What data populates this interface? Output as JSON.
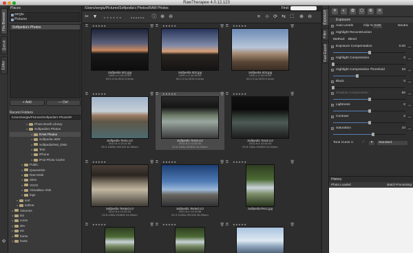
{
  "window": {
    "title": "RawTherapee 4.0.12.123"
  },
  "left_tabs": [
    "File Browser",
    "Queue",
    "Editor"
  ],
  "places": {
    "header": "Places",
    "items": [
      "sergiu",
      "Pictures"
    ],
    "favorite": "Softpedia's Photos"
  },
  "buttons": {
    "add": "+ Add",
    "del": "— Del"
  },
  "recent": {
    "label": "Recent Folders",
    "path": "/Users/sergiu/Pictures/Softpedia's Photos/R"
  },
  "tree": [
    {
      "label": "Photo Booth Library",
      "indent": 3,
      "selected": false
    },
    {
      "label": "Softpedia's Photos",
      "indent": 3,
      "selected": false
    },
    {
      "label": "RAW Photos",
      "indent": 4,
      "selected": true
    },
    {
      "label": "Softpedia HDR",
      "indent": 4,
      "selected": false
    },
    {
      "label": "SoftpediaTest_DNG",
      "indent": 4,
      "selected": false
    },
    {
      "label": "Test",
      "indent": 4,
      "selected": false
    },
    {
      "label": "iPhone",
      "indent": 4,
      "selected": false
    },
    {
      "label": "iPod Photo Cache",
      "indent": 4,
      "selected": false
    },
    {
      "label": "Public",
      "indent": 2,
      "selected": false
    },
    {
      "label": "Quarantine",
      "indent": 2,
      "selected": false
    },
    {
      "label": "Ram-Disk",
      "indent": 2,
      "selected": false
    },
    {
      "label": "Sites",
      "indent": 2,
      "selected": false
    },
    {
      "label": "VIIVO",
      "indent": 2,
      "selected": false
    },
    {
      "label": "VirtualBox VMs",
      "indent": 2,
      "selected": false
    },
    {
      "label": "logs",
      "indent": 2,
      "selected": false
    },
    {
      "label": "sort",
      "indent": 1,
      "selected": false
    },
    {
      "label": "softzet",
      "indent": 1,
      "selected": false
    },
    {
      "label": "Volumes",
      "indent": 0,
      "selected": false
    },
    {
      "label": "bin",
      "indent": 0,
      "selected": false
    },
    {
      "label": "cores",
      "indent": 0,
      "selected": false
    },
    {
      "label": "dev",
      "indent": 0,
      "selected": false
    },
    {
      "label": "etc",
      "indent": 0,
      "selected": false
    },
    {
      "label": "home",
      "indent": 0,
      "selected": false
    },
    {
      "label": "hosts",
      "indent": 0,
      "selected": false
    }
  ],
  "main": {
    "path": "/Users/sergiu/Pictures/Softpedia's Photos/RAW Photos",
    "find_label": "Find:"
  },
  "thumbs": [
    {
      "name": "Softpedia 001.jpg",
      "l1": "1900-1-0 00:00:00",
      "l2": "f/0.0 0.0s ISO0 0.0mm",
      "scene": "sunset"
    },
    {
      "name": "Softpedia 002.jpg",
      "l1": "1900-1-0 00:00:00",
      "l2": "f/0.0 0.0s ISO0 0.0mm",
      "scene": "sunset2"
    },
    {
      "name": "Softpedia 003.jpg",
      "l1": "1900-1-0 00:00:00",
      "l2": "f/0.0 0.0s ISO0 0.0mm",
      "scene": "ruin"
    },
    {
      "name": "Softpedia Test1.cr2",
      "l1": "2012-6-4 13:11:59",
      "l2": "f/5.3 1/800s ISO100 40.00mm",
      "scene": "canal"
    },
    {
      "name": "Softpedia Test3.cr2",
      "l1": "2012-6-4 12:52:34",
      "l2": "f/2.8 1/50s ISO800 24.00mm",
      "scene": "arch"
    },
    {
      "name": "Softpedia Test4.cr2",
      "l1": "2012-6-4 12:52:34",
      "l2": "f/2.8 1/50s ISO800 24.00mm",
      "scene": "archdark"
    },
    {
      "name": "Softpedia-Tested.cr2",
      "l1": "2012-6-4 12:52:34",
      "l2": "f/2.8 1/50s ISO800 24.00mm",
      "scene": "arch2"
    },
    {
      "name": "Softpedia Tested.cr2",
      "l1": "2012-6-4 13:16:58",
      "l2": "f/1.9 1/400s ISO100 35.00mm",
      "scene": "sky"
    },
    {
      "name": "SoftpediaTest1.jpg",
      "l1": "",
      "l2": "",
      "scene": "waterfall"
    },
    {
      "name": "",
      "l1": "",
      "l2": "",
      "scene": "waterfall"
    },
    {
      "name": "",
      "l1": "",
      "l2": "",
      "scene": "waterfall"
    },
    {
      "name": "",
      "l1": "",
      "l2": "",
      "scene": "bridge"
    }
  ],
  "right_tabs": [
    "Exposure",
    "Filter",
    "Fast Export"
  ],
  "exposure": {
    "section": "Exposure",
    "auto_levels": "Auto Levels",
    "clip_label": "Clip %",
    "clip_value": "0.02",
    "neutral": "Neutra",
    "highlight_recon": "Highlight Reconstruction",
    "method_label": "Method:",
    "method_value": "Blend",
    "sliders": [
      {
        "label": "Exposure Compensation",
        "value": "0.00",
        "frac": 0.5,
        "dim": false
      },
      {
        "label": "Highlight Compression",
        "value": "0",
        "frac": 0.0,
        "dim": false
      },
      {
        "label": "Highlight Compression Threshold",
        "value": "33",
        "frac": 0.33,
        "dim": false
      },
      {
        "label": "Black",
        "value": "0",
        "frac": 0.0,
        "dim": false
      },
      {
        "label": "Shadow Compression",
        "value": "50",
        "frac": 0.5,
        "dim": true
      },
      {
        "label": "Lightness",
        "value": "0",
        "frac": 0.5,
        "dim": false
      },
      {
        "label": "Contrast",
        "value": "0",
        "frac": 0.5,
        "dim": false
      },
      {
        "label": "Saturation",
        "value": "10",
        "frac": 0.55,
        "dim": false
      }
    ],
    "tone_curve_label": "Tone Curve 1:",
    "tone_curve_value": "Standard"
  },
  "history": {
    "header": "History",
    "col1": "Photo Loaded",
    "col2": "Batch Processing"
  },
  "colors": {
    "accent": "#5a7fb2",
    "selected": "#4a4a4a"
  }
}
